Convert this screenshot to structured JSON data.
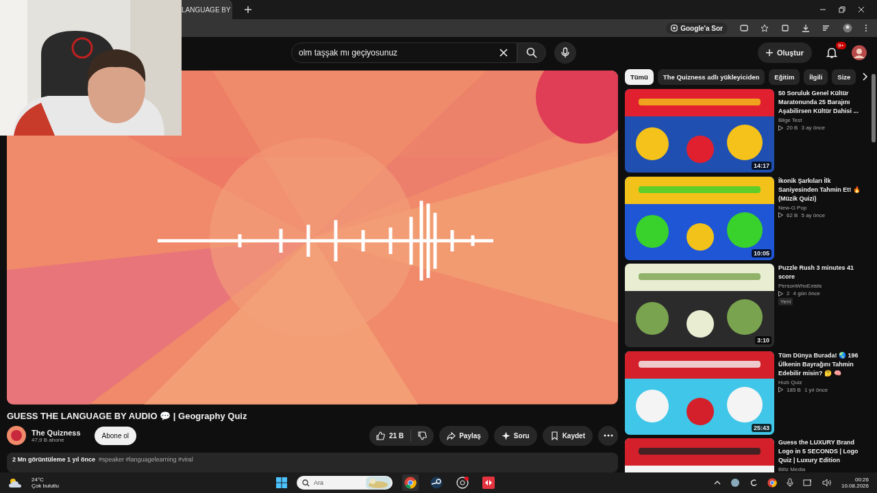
{
  "browser": {
    "tab_title": "LANGUAGE BY",
    "ask_google": "Google'a Sor"
  },
  "header": {
    "search_value": "olm taşşak mı geçiyosunuz",
    "create_label": "Oluştur",
    "notification_count": "9+"
  },
  "video": {
    "title": "GUESS THE LANGUAGE BY AUDIO 💬 | Geography Quiz",
    "channel": "The Quizness",
    "subscribers": "47,9 B abone",
    "subscribe_label": "Abone ol",
    "likes": "21 B",
    "actions": [
      "Paylaş",
      "Soru",
      "Kaydet"
    ],
    "stats": "2 Mn görüntüleme  1 yıl önce",
    "tags": "#speaker #languagelearning #viral"
  },
  "chips": [
    {
      "label": "Tümü",
      "selected": true
    },
    {
      "label": "The Quizness adlı yükleyiciden",
      "selected": false
    },
    {
      "label": "Eğitim",
      "selected": false
    },
    {
      "label": "İlgili",
      "selected": false
    },
    {
      "label": "Size",
      "selected": false
    }
  ],
  "recommendations": [
    {
      "title": "50 Soruluk Genel Kültür Maratonunda 25 Barajını Aşabilirsen Kültür Dahisi ...",
      "channel": "Bilge Test",
      "views": "20 B",
      "age": "3 ay önce",
      "duration": "14:17"
    },
    {
      "title": "İkonik Şarkıları İlk Saniyesinden Tahmin Et! 🔥 (Müzik Quizi)",
      "channel": "New-G Pop",
      "views": "62 B",
      "age": "5 ay önce",
      "duration": "10:05"
    },
    {
      "title": "Puzzle Rush 3 minutes 41 score",
      "channel": "PersonWhoExists",
      "views": "2",
      "age": "4 gün önce",
      "duration": "3:10",
      "badge": "Yeni"
    },
    {
      "title": "Tüm Dünya Burada! 🌏 196 Ülkenin Bayrağını Tahmin Edebilir misin? 🤔 🧠",
      "channel": "Hızlı Quiz",
      "views": "185 B",
      "age": "1 yıl önce",
      "duration": "25:43"
    },
    {
      "title": "Guess the LUXURY Brand Logo in 5 SECONDS | Logo Quiz | Luxury Edition",
      "channel": "Blitz Media"
    }
  ],
  "taskbar": {
    "temperature": "24°C",
    "weather": "Çok bulutlu",
    "search_label": "Ara",
    "time": "00:26",
    "date": "10.08.2026"
  }
}
